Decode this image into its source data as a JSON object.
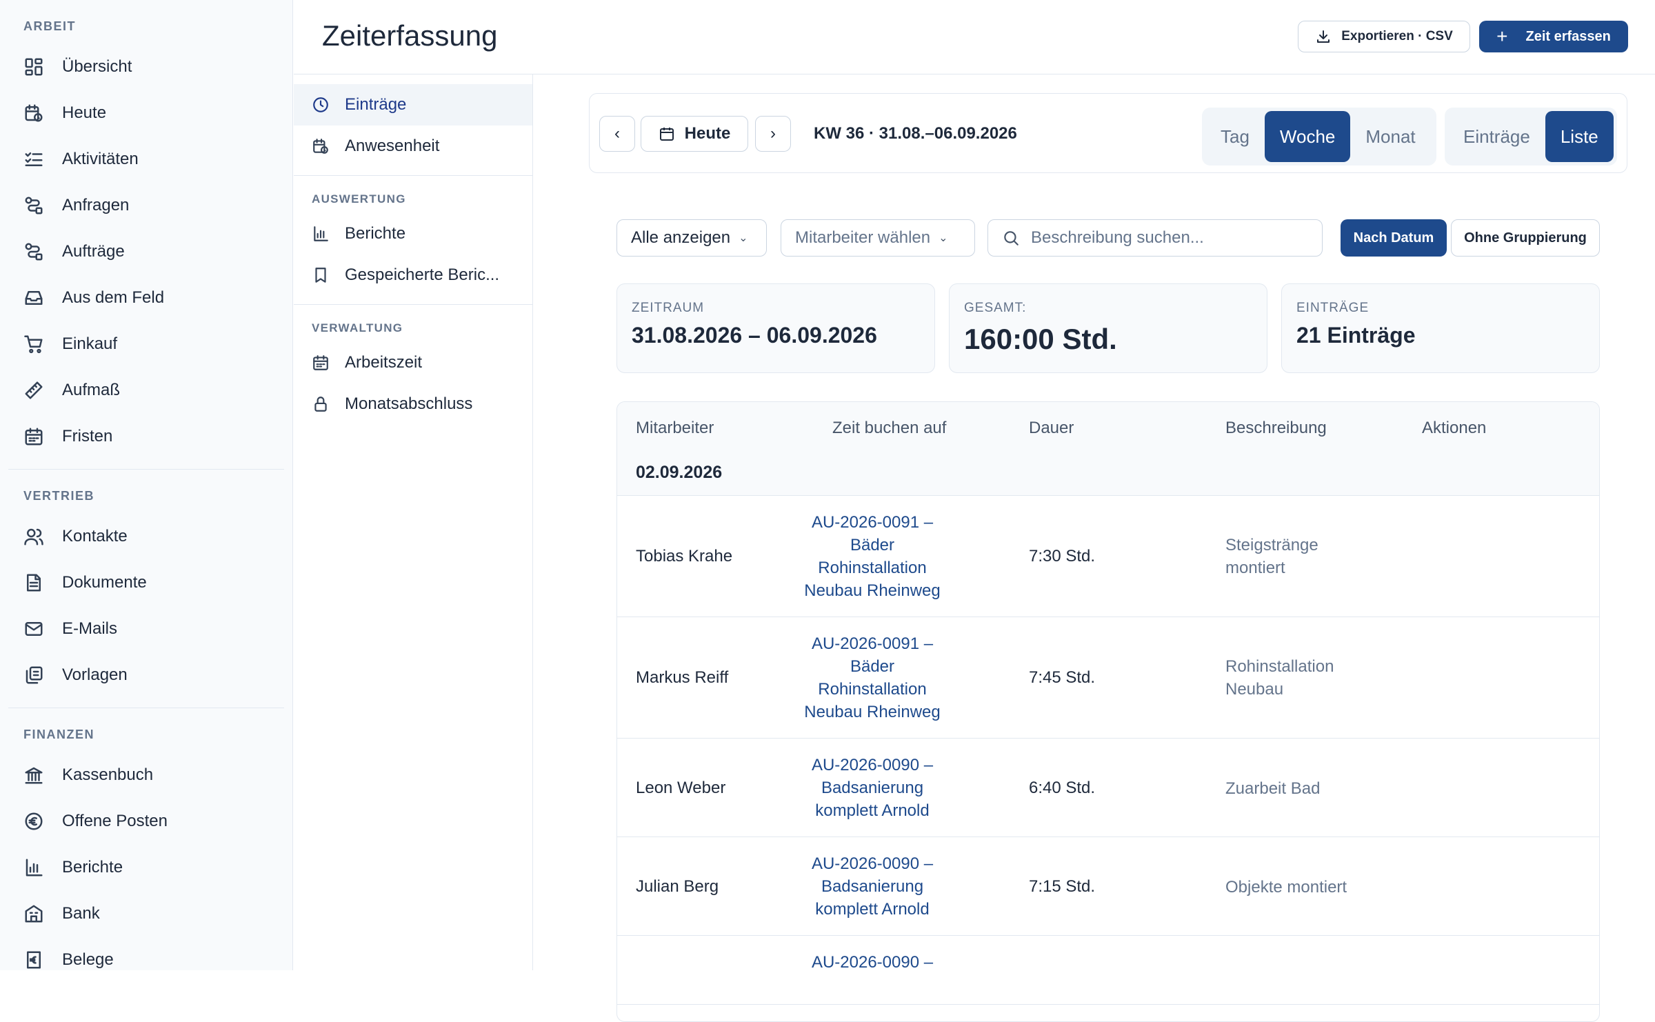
{
  "sidebar": {
    "sections": [
      {
        "heading": "ARBEIT",
        "items": [
          {
            "label": "Übersicht",
            "icon": "dashboard-icon"
          },
          {
            "label": "Heute",
            "icon": "calendar-clock-icon"
          },
          {
            "label": "Aktivitäten",
            "icon": "list-check-icon"
          },
          {
            "label": "Anfragen",
            "icon": "route-icon"
          },
          {
            "label": "Aufträge",
            "icon": "route-icon"
          },
          {
            "label": "Aus dem Feld",
            "icon": "inbox-icon"
          },
          {
            "label": "Einkauf",
            "icon": "cart-icon"
          },
          {
            "label": "Aufmaß",
            "icon": "ruler-icon"
          },
          {
            "label": "Fristen",
            "icon": "calendar-icon"
          }
        ]
      },
      {
        "heading": "VERTRIEB",
        "items": [
          {
            "label": "Kontakte",
            "icon": "users-icon"
          },
          {
            "label": "Dokumente",
            "icon": "document-icon"
          },
          {
            "label": "E-Mails",
            "icon": "mail-icon"
          },
          {
            "label": "Vorlagen",
            "icon": "copy-icon"
          }
        ]
      },
      {
        "heading": "FINANZEN",
        "items": [
          {
            "label": "Kassenbuch",
            "icon": "bank-icon"
          },
          {
            "label": "Offene Posten",
            "icon": "euro-circle-icon"
          },
          {
            "label": "Berichte",
            "icon": "bar-chart-icon"
          },
          {
            "label": "Bank",
            "icon": "building-icon"
          },
          {
            "label": "Belege",
            "icon": "receipt-icon"
          }
        ]
      }
    ]
  },
  "subnav": {
    "items_top": [
      {
        "label": "Einträge",
        "icon": "clock-icon",
        "active": true
      },
      {
        "label": "Anwesenheit",
        "icon": "calendar-clock-icon"
      }
    ],
    "auswertung_heading": "AUSWERTUNG",
    "items_auswertung": [
      {
        "label": "Berichte",
        "icon": "bar-chart-icon"
      },
      {
        "label": "Gespeicherte Beric...",
        "icon": "bookmark-icon"
      }
    ],
    "verwaltung_heading": "VERWALTUNG",
    "items_verwaltung": [
      {
        "label": "Arbeitszeit",
        "icon": "calendar-icon"
      },
      {
        "label": "Monatsabschluss",
        "icon": "lock-icon"
      }
    ]
  },
  "header": {
    "title": "Zeiterfassung",
    "export_label": "Exportieren · CSV",
    "primary_label": "Zeit erfassen"
  },
  "navigator": {
    "today_label": "Heute",
    "week_label": "KW 36 · 31.08.–06.09.2026",
    "range_options": [
      "Tag",
      "Woche",
      "Monat"
    ],
    "range_selected": "Woche",
    "view_options": [
      "Einträge",
      "Liste"
    ],
    "view_selected": "Liste"
  },
  "filters": {
    "show_all": "Alle anzeigen",
    "employee_placeholder": "Mitarbeiter wählen",
    "search_placeholder": "Beschreibung suchen...",
    "sort_label": "Nach Datum",
    "group_label": "Ohne Gruppierung"
  },
  "stats": {
    "period_label": "ZEITRAUM",
    "period_value": "31.08.2026 – 06.09.2026",
    "total_label": "GESAMT:",
    "total_value": "160:00 Std.",
    "entries_label": "EINTRÄGE",
    "entries_value": "21 Einträge"
  },
  "table": {
    "columns": [
      "Mitarbeiter",
      "Zeit buchen auf",
      "Dauer",
      "Beschreibung",
      "Aktionen"
    ],
    "group_date": "02.09.2026",
    "rows": [
      {
        "employee": "Tobias Krahe",
        "booking_lines": [
          "AU-2026-0091 –",
          "Bäder",
          "Rohinstallation",
          "Neubau Rheinweg"
        ],
        "duration": "7:30 Std.",
        "description": "Steigstränge montiert"
      },
      {
        "employee": "Markus Reiff",
        "booking_lines": [
          "AU-2026-0091 –",
          "Bäder",
          "Rohinstallation",
          "Neubau Rheinweg"
        ],
        "duration": "7:45 Std.",
        "description": "Rohinstallation Neubau"
      },
      {
        "employee": "Leon Weber",
        "booking_lines": [
          "AU-2026-0090 –",
          "Badsanierung",
          "komplett Arnold"
        ],
        "duration": "6:40 Std.",
        "description": "Zuarbeit Bad"
      },
      {
        "employee": "Julian Berg",
        "booking_lines": [
          "AU-2026-0090 –",
          "Badsanierung",
          "komplett Arnold"
        ],
        "duration": "7:15 Std.",
        "description": "Objekte montiert"
      },
      {
        "employee": "",
        "booking_lines": [
          "AU-2026-0090 –"
        ],
        "duration": "",
        "description": ""
      }
    ]
  },
  "colors": {
    "accent": "#1e4a8c",
    "muted": "#64748b",
    "border": "#e2e8f0"
  }
}
